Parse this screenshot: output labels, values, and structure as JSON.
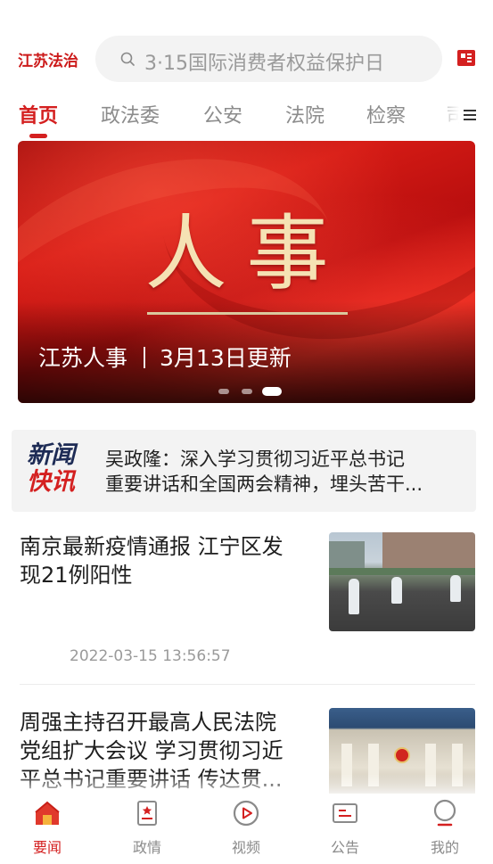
{
  "header": {
    "logo": "江苏法治",
    "search_placeholder": "3·15国际消费者权益保护日"
  },
  "tabs": [
    {
      "label": "首页",
      "active": true
    },
    {
      "label": "政法委",
      "active": false
    },
    {
      "label": "公安",
      "active": false
    },
    {
      "label": "法院",
      "active": false
    },
    {
      "label": "检察",
      "active": false
    },
    {
      "label": "司",
      "active": false
    }
  ],
  "banner": {
    "headline": "人事",
    "caption_source": "江苏人事",
    "caption_update": "3月13日更新",
    "slides": 3,
    "active_slide": 3
  },
  "flash": {
    "logo_line1": "新闻",
    "logo_line2": "快讯",
    "text_line1": "吴政隆：深入学习贯彻习近平总书记",
    "text_line2": "重要讲话和全国两会精神，埋头苦干..."
  },
  "articles": [
    {
      "title_line1": "南京最新疫情通报 江宁区发",
      "title_line2": "现21例阳性",
      "time": "2022-03-15 13:56:57"
    },
    {
      "title_line1": "周强主持召开最高人民法院",
      "title_line2": "党组扩大会议 学习贯彻习近",
      "title_line3": "平总书记重要讲话 传达贯..."
    }
  ],
  "bottom_nav": [
    {
      "label": "要闻",
      "icon": "home-icon",
      "active": true
    },
    {
      "label": "政情",
      "icon": "document-star-icon",
      "active": false
    },
    {
      "label": "视频",
      "icon": "video-play-icon",
      "active": false
    },
    {
      "label": "公告",
      "icon": "notice-icon",
      "active": false
    },
    {
      "label": "我的",
      "icon": "profile-icon",
      "active": false
    }
  ],
  "colors": {
    "accent": "#d42020",
    "text_primary": "#1e1e1e",
    "text_secondary": "#9a9a9a",
    "flash_blue": "#1d2b55"
  }
}
